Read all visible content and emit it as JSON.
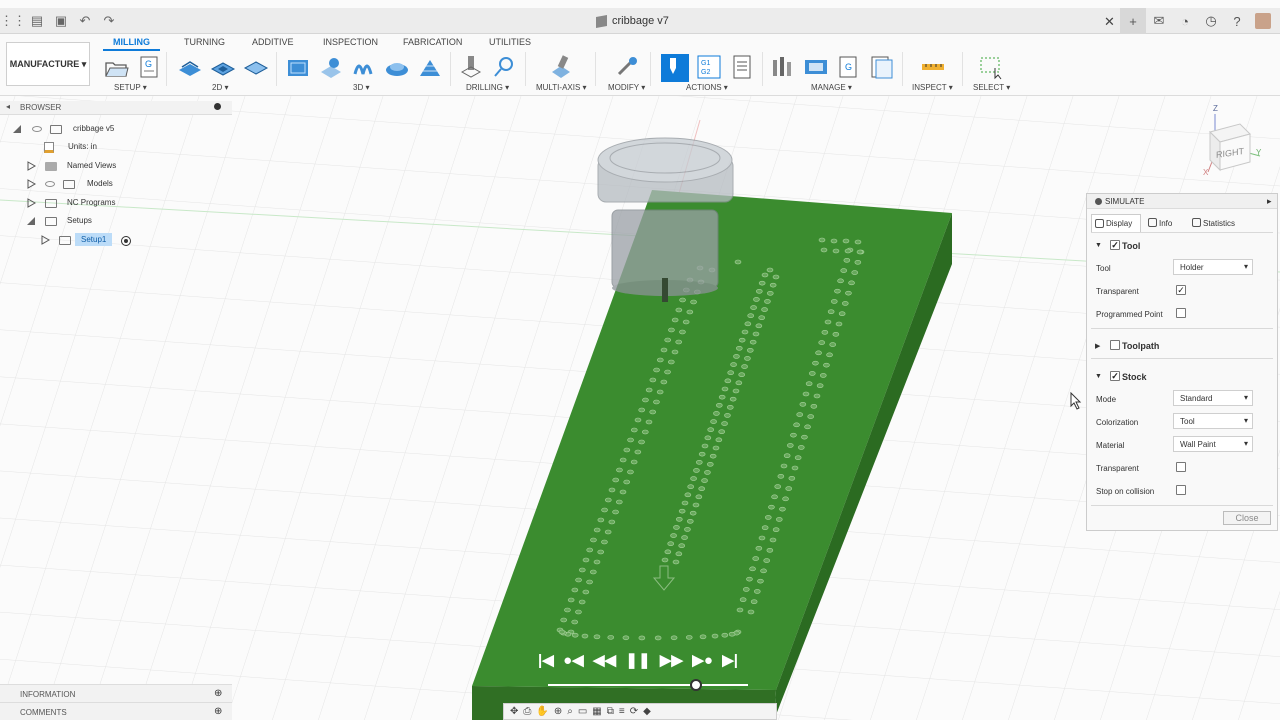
{
  "document": {
    "title": "cribbage v7"
  },
  "workspace": {
    "label": "MANUFACTURE"
  },
  "tabs": [
    {
      "label": "MILLING",
      "active": true
    },
    {
      "label": "TURNING"
    },
    {
      "label": "ADDITIVE"
    },
    {
      "label": "INSPECTION"
    },
    {
      "label": "FABRICATION"
    },
    {
      "label": "UTILITIES"
    }
  ],
  "groups": {
    "setup": "SETUP ▾",
    "d2": "2D ▾",
    "d3": "3D ▾",
    "drilling": "DRILLING ▾",
    "multiaxis": "MULTI-AXIS ▾",
    "modify": "MODIFY ▾",
    "actions": "ACTIONS ▾",
    "manage": "MANAGE ▾",
    "inspect": "INSPECT ▾",
    "select": "SELECT ▾"
  },
  "gcode_icon": "G1\nG2",
  "browser": {
    "title": "BROWSER",
    "items": [
      {
        "label": "cribbage v5"
      },
      {
        "label": "Units: in"
      },
      {
        "label": "Named Views"
      },
      {
        "label": "Models"
      },
      {
        "label": "NC Programs"
      },
      {
        "label": "Setups"
      },
      {
        "label": "Setup1"
      }
    ]
  },
  "viewcube": {
    "face": "RIGHT",
    "axis_z": "Z",
    "axis_y": "Y",
    "axis_x": "X"
  },
  "simulate": {
    "title": "SIMULATE",
    "tabs": [
      "Display",
      "Info",
      "Statistics"
    ],
    "tool_section": "Tool",
    "tool_label": "Tool",
    "tool_value": "Holder",
    "transparent_label": "Transparent",
    "programmed_point_label": "Programmed Point",
    "toolpath_section": "Toolpath",
    "stock_section": "Stock",
    "mode_label": "Mode",
    "mode_value": "Standard",
    "colorization_label": "Colorization",
    "colorization_value": "Tool",
    "material_label": "Material",
    "material_value": "Wall Paint",
    "stock_transparent_label": "Transparent",
    "stop_on_collision_label": "Stop on collision",
    "close_label": "Close",
    "checks": {
      "tool": true,
      "tool_transparent": true,
      "programmed_point": false,
      "toolpath": false,
      "stock": true,
      "stock_transparent": false,
      "stop_on_collision": false
    }
  },
  "bottom": {
    "information": "INFORMATION",
    "comments": "COMMENTS"
  },
  "playback": {
    "buttons": [
      "|◀",
      "●◀",
      "◀◀",
      "❚❚",
      "▶▶",
      "▶●",
      "▶|"
    ],
    "position": 0.74
  },
  "colors": {
    "stock_top": "#3b8c2f",
    "stock_side": "#2b6b21",
    "accent": "#0e7bd9"
  }
}
